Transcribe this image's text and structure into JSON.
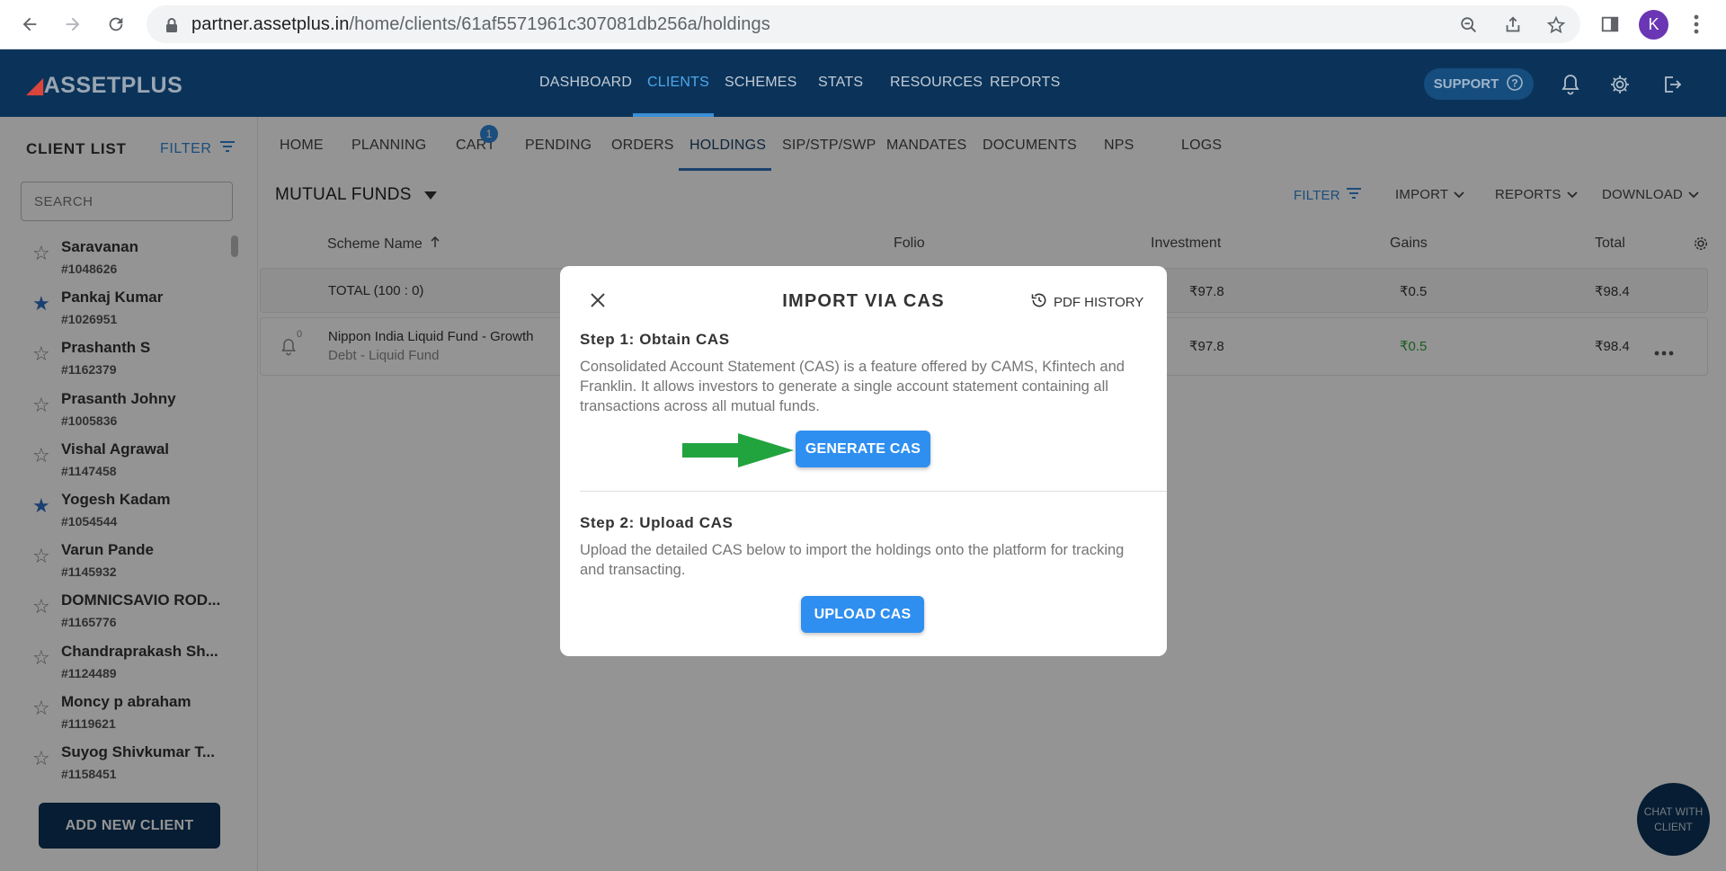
{
  "browser": {
    "url_host": "partner.assetplus.in",
    "url_path": "/home/clients/61af5571961c307081db256a/holdings",
    "avatar_letter": "K"
  },
  "header": {
    "logo": "ASSETPLUS",
    "nav": [
      "DASHBOARD",
      "CLIENTS",
      "SCHEMES",
      "STATS",
      "RESOURCES",
      "REPORTS"
    ],
    "active_nav": "CLIENTS",
    "support_label": "SUPPORT"
  },
  "sidebar": {
    "title": "CLIENT LIST",
    "filter_label": "FILTER",
    "search_placeholder": "SEARCH",
    "clients": [
      {
        "name": "Saravanan",
        "id": "#1048626",
        "starred": false
      },
      {
        "name": "Pankaj Kumar",
        "id": "#1026951",
        "starred": true
      },
      {
        "name": "Prashanth S",
        "id": "#1162379",
        "starred": false
      },
      {
        "name": "Prasanth Johny",
        "id": "#1005836",
        "starred": false
      },
      {
        "name": "Vishal Agrawal",
        "id": "#1147458",
        "starred": false
      },
      {
        "name": "Yogesh Kadam",
        "id": "#1054544",
        "starred": true
      },
      {
        "name": "Varun Pande",
        "id": "#1145932",
        "starred": false
      },
      {
        "name": "DOMNICSAVIO ROD...",
        "id": "#1165776",
        "starred": false
      },
      {
        "name": "Chandraprakash Sh...",
        "id": "#1124489",
        "starred": false
      },
      {
        "name": "Moncy p abraham",
        "id": "#1119621",
        "starred": false
      },
      {
        "name": "Suyog Shivkumar T...",
        "id": "#1158451",
        "starred": false
      }
    ],
    "add_client_label": "ADD NEW CLIENT"
  },
  "subnav": {
    "tabs": [
      "HOME",
      "PLANNING",
      "CART",
      "PENDING",
      "ORDERS",
      "HOLDINGS",
      "SIP/STP/SWP",
      "MANDATES",
      "DOCUMENTS",
      "NPS",
      "LOGS"
    ],
    "active_tab": "HOLDINGS",
    "cart_count": "1"
  },
  "holdings": {
    "category": "MUTUAL FUNDS",
    "toolbar": {
      "filter": "FILTER",
      "import": "IMPORT",
      "reports": "REPORTS",
      "download": "DOWNLOAD"
    },
    "columns": {
      "scheme": "Scheme Name",
      "folio": "Folio",
      "investment": "Investment",
      "gains": "Gains",
      "total": "Total"
    },
    "total_row": {
      "label": "TOTAL (100 : 0)",
      "investment": "₹97.8",
      "gains": "₹0.5",
      "total": "₹98.4"
    },
    "rows": [
      {
        "bell_count": "0",
        "scheme": "Nippon India Liquid Fund - Growth",
        "category": "Debt - Liquid Fund",
        "investment": "₹97.8",
        "gains": "₹0.5",
        "total": "₹98.4"
      }
    ]
  },
  "modal": {
    "title": "IMPORT VIA CAS",
    "pdf_history": "PDF HISTORY",
    "step1_title": "Step 1: Obtain CAS",
    "step1_desc": "Consolidated Account Statement (CAS) is a feature offered by CAMS, Kfintech and Franklin. It allows investors to generate a single account statement containing all transactions across all mutual funds.",
    "generate_label": "GENERATE CAS",
    "step2_title": "Step 2: Upload CAS",
    "step2_desc": "Upload the detailed CAS below to import the holdings onto the platform for tracking and transacting.",
    "upload_label": "UPLOAD CAS"
  },
  "chat": {
    "line1": "CHAT WITH",
    "line2": "CLIENT"
  },
  "colors": {
    "navy": "#0b3359",
    "primary_blue": "#2f8ff0",
    "arrow_green": "#21a33e",
    "gain_green": "#2e9d3a"
  }
}
